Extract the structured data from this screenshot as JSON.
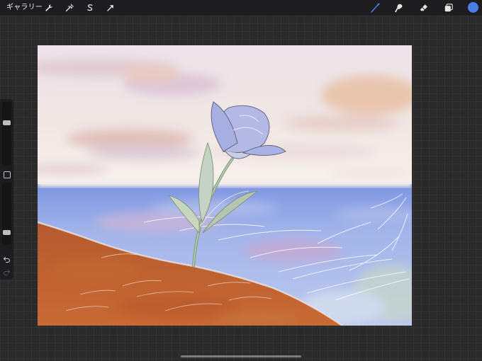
{
  "toolbar": {
    "gallery_label": "ギャラリー",
    "left_tools": [
      "wrench-icon",
      "magic-wand-icon",
      "selection-icon",
      "transform-arrow-icon"
    ],
    "right_tools": [
      "brush-icon",
      "smudge-icon",
      "eraser-icon",
      "layers-icon"
    ],
    "active_tool": "brush-icon",
    "current_color": "#4a7de8",
    "active_tool_color": "#4a7de8",
    "inactive_icon_color": "#e6e6e6"
  },
  "sidebar": {
    "brush_size_level": 0.7,
    "opacity_level": 0.15,
    "buttons": [
      "undo-icon",
      "redo-icon"
    ]
  },
  "canvas": {
    "subject": "painting",
    "palette": {
      "sky": "#f4ece6",
      "sea": "#9eb4ea",
      "ground": "#c35f2c",
      "flower": "#b2b8e4"
    }
  }
}
